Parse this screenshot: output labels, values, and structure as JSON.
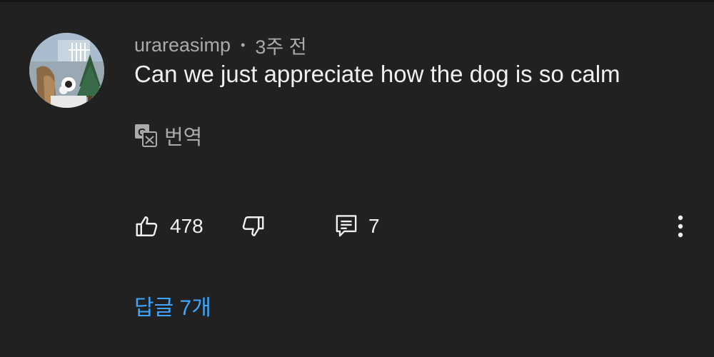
{
  "comment": {
    "author": "urareasimp",
    "separator": "•",
    "time_ago": "3주 전",
    "text": "Can we just appreciate how the dog is so calm"
  },
  "translate": {
    "label": "번역",
    "icon": "translate-icon"
  },
  "actions": {
    "like_icon": "thumbs-up-icon",
    "like_count": "478",
    "dislike_icon": "thumbs-down-icon",
    "reply_icon": "reply-icon",
    "reply_count": "7",
    "more_icon": "more-vertical-icon"
  },
  "replies_link": "답글 7개",
  "colors": {
    "background": "#212121",
    "text_primary": "#f1f1f1",
    "text_secondary": "#aaaaaa",
    "link": "#3ea6ff"
  }
}
